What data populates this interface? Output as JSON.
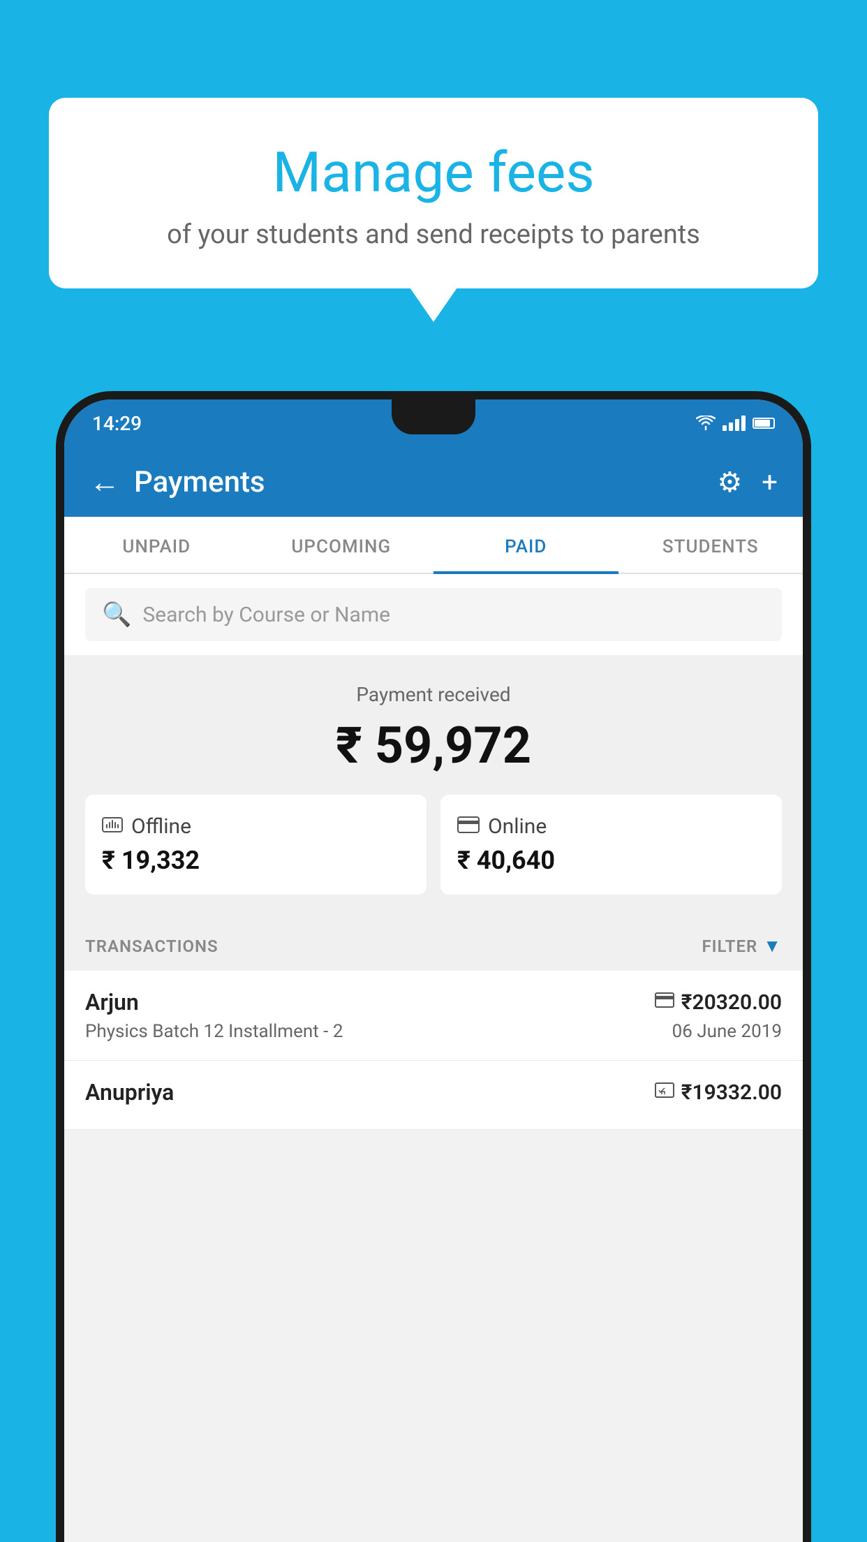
{
  "background_color": "#1ab3e6",
  "speech_bubble": {
    "title": "Manage fees",
    "subtitle": "of your students and send receipts to parents"
  },
  "status_bar": {
    "time": "14:29"
  },
  "app_bar": {
    "title": "Payments",
    "back_icon": "←",
    "settings_icon": "⚙",
    "add_icon": "+"
  },
  "tabs": [
    {
      "label": "UNPAID",
      "active": false
    },
    {
      "label": "UPCOMING",
      "active": false
    },
    {
      "label": "PAID",
      "active": true
    },
    {
      "label": "STUDENTS",
      "active": false
    }
  ],
  "search": {
    "placeholder": "Search by Course or Name"
  },
  "payment_summary": {
    "received_label": "Payment received",
    "total_amount": "₹ 59,972",
    "offline": {
      "label": "Offline",
      "amount": "₹ 19,332"
    },
    "online": {
      "label": "Online",
      "amount": "₹ 40,640"
    }
  },
  "transactions": {
    "section_label": "TRANSACTIONS",
    "filter_label": "FILTER",
    "items": [
      {
        "name": "Arjun",
        "course": "Physics Batch 12 Installment - 2",
        "amount": "₹20320.00",
        "date": "06 June 2019",
        "payment_type": "online"
      },
      {
        "name": "Anupriya",
        "course": "",
        "amount": "₹19332.00",
        "date": "",
        "payment_type": "offline"
      }
    ]
  }
}
